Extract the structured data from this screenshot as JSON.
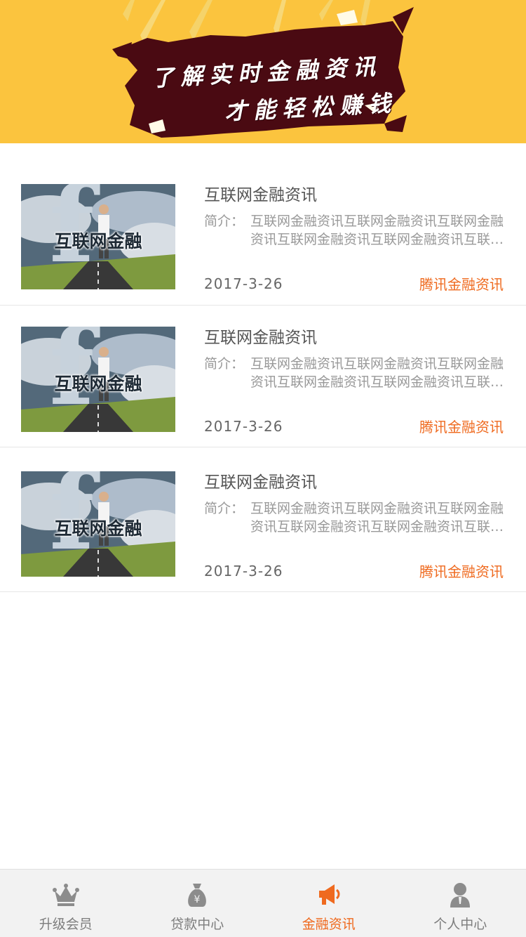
{
  "banner": {
    "line1": "了解实时金融资讯",
    "line2": "才能轻松赚钱",
    "bg_color": "#fbc43e",
    "plate_color": "#4a0a12"
  },
  "news": [
    {
      "thumb_caption": "互联网金融",
      "title": "互联网金融资讯",
      "summary_label": "简介：",
      "summary": "互联网金融资讯互联网金融资讯互联网金融资讯互联网金融资讯互联网金融资讯互联网金融资讯",
      "date": "2017-3-26",
      "source": "腾讯金融资讯"
    },
    {
      "thumb_caption": "互联网金融",
      "title": "互联网金融资讯",
      "summary_label": "简介：",
      "summary": "互联网金融资讯互联网金融资讯互联网金融资讯互联网金融资讯互联网金融资讯互联网金融资讯",
      "date": "2017-3-26",
      "source": "腾讯金融资讯"
    },
    {
      "thumb_caption": "互联网金融",
      "title": "互联网金融资讯",
      "summary_label": "简介：",
      "summary": "互联网金融资讯互联网金融资讯互联网金融资讯互联网金融资讯互联网金融资讯互联网金融资讯",
      "date": "2017-3-26",
      "source": "腾讯金融资讯"
    }
  ],
  "tabbar": {
    "active_color": "#ef6a1f",
    "inactive_color": "#7d7d7d",
    "tabs": [
      {
        "label": "升级会员",
        "icon": "crown-icon",
        "active": false
      },
      {
        "label": "贷款中心",
        "icon": "money-bag-icon",
        "active": false
      },
      {
        "label": "金融资讯",
        "icon": "megaphone-icon",
        "active": true
      },
      {
        "label": "个人中心",
        "icon": "user-icon",
        "active": false
      }
    ]
  }
}
